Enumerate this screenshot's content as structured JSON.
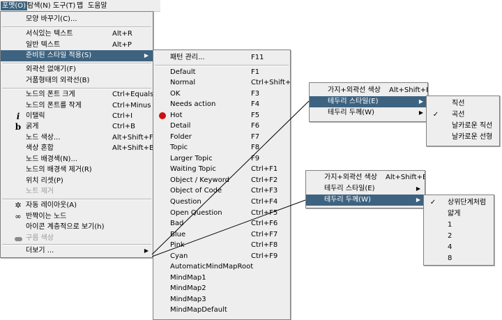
{
  "menubar": [
    "포멧(O)",
    "탐색(N)",
    "도구(T)",
    "맵",
    "도움말"
  ],
  "format_menu": [
    {
      "label": "모양 바꾸기(C)..."
    },
    {
      "label": "서식있는 텍스트",
      "accel": "Alt+R"
    },
    {
      "label": "일반 텍스트",
      "accel": "Alt+P"
    },
    {
      "label": "준비된 스타일 적용(S)",
      "submenu": true
    },
    {
      "label": "외곽선 없애기(F)"
    },
    {
      "label": "거품형태의 외곽선(B)"
    },
    {
      "label": "노드의 폰트 크게",
      "accel": "Ctrl+Equals"
    },
    {
      "label": "노드의 폰트를 작게",
      "accel": "Ctrl+Minus"
    },
    {
      "label": "이탤릭",
      "accel": "Ctrl+I",
      "icon": "i"
    },
    {
      "label": "굵게",
      "accel": "Ctrl+B",
      "icon": "b"
    },
    {
      "label": "노드 색상...",
      "accel": "Alt+Shift+F"
    },
    {
      "label": "색상 혼합",
      "accel": "Alt+Shift+B"
    },
    {
      "label": "노드 배경색(N)..."
    },
    {
      "label": "노드의 배경색 제거(R)"
    },
    {
      "label": "위치 리셋(P)"
    },
    {
      "label": "노트 제거"
    },
    {
      "label": "자동 레이아웃(A)"
    },
    {
      "label": "반짝이는 노드"
    },
    {
      "label": "아이콘 계층적으로 보기(h)"
    },
    {
      "label": "구름 색상"
    },
    {
      "label": "더보기 ..."
    }
  ],
  "style_menu": [
    {
      "label": "패턴 관리...",
      "accel": "F11"
    },
    {
      "label": "Default",
      "accel": "F1"
    },
    {
      "label": "Normal",
      "accel": "Ctrl+Shift+N"
    },
    {
      "label": "OK",
      "accel": "F3"
    },
    {
      "label": "Needs action",
      "accel": "F4"
    },
    {
      "label": "Hot",
      "accel": "F5"
    },
    {
      "label": "Detail",
      "accel": "F6"
    },
    {
      "label": "Folder",
      "accel": "F7"
    },
    {
      "label": "Topic",
      "accel": "F8"
    },
    {
      "label": "Larger Topic",
      "accel": "F9"
    },
    {
      "label": "Waiting Topic",
      "accel": "Ctrl+F1"
    },
    {
      "label": "Object / Keyword",
      "accel": "Ctrl+F2"
    },
    {
      "label": "Object of Code",
      "accel": "Ctrl+F3"
    },
    {
      "label": "Question",
      "accel": "Ctrl+F4"
    },
    {
      "label": "Open Question",
      "accel": "Ctrl+F5"
    },
    {
      "label": "Bad",
      "accel": "Ctrl+F6"
    },
    {
      "label": "Blue",
      "accel": "Ctrl+F7"
    },
    {
      "label": "Pink",
      "accel": "Ctrl+F8"
    },
    {
      "label": "Cyan",
      "accel": "Ctrl+F9"
    },
    {
      "label": "AutomaticMindMapRoot"
    },
    {
      "label": "MindMap1"
    },
    {
      "label": "MindMap2"
    },
    {
      "label": "MindMap3"
    },
    {
      "label": "MindMapDefault"
    }
  ],
  "edge_menu_a": [
    {
      "label": "가지+외곽선 색상",
      "accel": "Alt+Shift+E"
    },
    {
      "label": "테두리 스타일(E)",
      "submenu": true
    },
    {
      "label": "테두리 두께(W)",
      "submenu": true
    }
  ],
  "edge_style_sub": [
    {
      "label": "직선"
    },
    {
      "label": "곡선",
      "checked": true
    },
    {
      "label": "날카로운 직선"
    },
    {
      "label": "날카로운 선형"
    }
  ],
  "edge_menu_b": [
    {
      "label": "가지+외곽선 색상",
      "accel": "Alt+Shift+E"
    },
    {
      "label": "테두리 스타일(E)",
      "submenu": true
    },
    {
      "label": "테두리 두께(W)",
      "submenu": true
    }
  ],
  "edge_width_sub": [
    {
      "label": "상위단계처럼",
      "checked": true
    },
    {
      "label": "얇게"
    },
    {
      "label": "1"
    },
    {
      "label": "2"
    },
    {
      "label": "4"
    },
    {
      "label": "8"
    }
  ],
  "icons": {
    "submenu_arrow": "▶",
    "check": "✓",
    "italic": "i",
    "bold": "b"
  }
}
